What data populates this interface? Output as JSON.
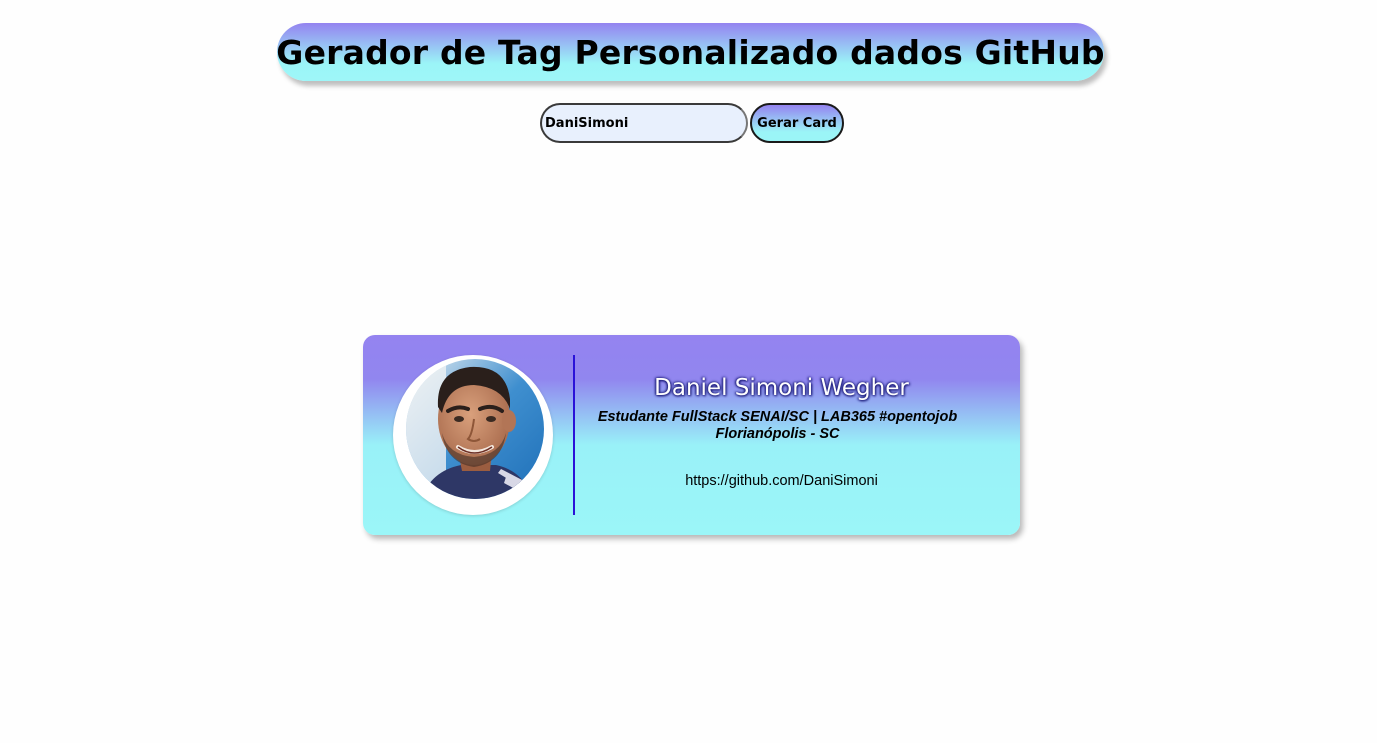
{
  "header": {
    "title": "Gerador de Tag Personalizado dados GitHub"
  },
  "search": {
    "value": "DaniSimoni",
    "button_label": "Gerar Card"
  },
  "card": {
    "name": "Daniel Simoni Wegher",
    "bio": "Estudante FullStack SENAI/SC | LAB365 #opentojob",
    "location": "Florianópolis - SC",
    "url": "https://github.com/DaniSimoni",
    "avatar_icon": "profile-photo"
  },
  "colors": {
    "gradient_top": "#9483f0",
    "gradient_bottom": "#9bf5f7",
    "divider": "#2a12d8",
    "input_background": "#e8f0fd"
  }
}
